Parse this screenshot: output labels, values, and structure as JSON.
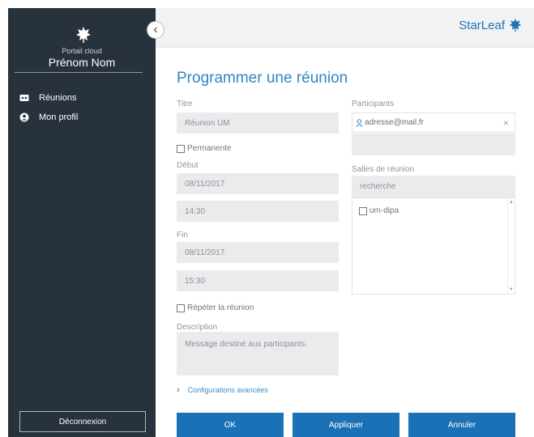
{
  "sidebar": {
    "portal_label": "Portail cloud",
    "user_name": "Prénom Nom",
    "items": [
      {
        "label": "Réunions",
        "icon": "meetings-icon"
      },
      {
        "label": "Mon profil",
        "icon": "profile-icon"
      }
    ],
    "logout_label": "Déconnexion"
  },
  "header": {
    "brand": "StarLeaf"
  },
  "form": {
    "title": "Programmer une réunion",
    "titre_label": "Titre",
    "titre_value": "Réunion UM",
    "permanente_label": "Permanente",
    "debut_label": "Début",
    "debut_date": "08/11/2017",
    "debut_time": "14:30",
    "fin_label": "Fin",
    "fin_date": "08/11/2017",
    "fin_time": "15:30",
    "repeter_label": "Répéter la réunion",
    "description_label": "Description",
    "description_placeholder": "Message destiné aux participants.",
    "participants_label": "Participants",
    "participant_email": "adresse@mail.fr",
    "salles_label": "Salles de réunion",
    "salles_search_placeholder": "recherche",
    "rooms": [
      {
        "label": "um-dipa",
        "checked": false
      }
    ],
    "advanced_label": "Configurations avancées"
  },
  "buttons": {
    "ok": "OK",
    "apply": "Appliquer",
    "cancel": "Annuler"
  },
  "colors": {
    "sidebar": "#27323d",
    "accent": "#1a71b5",
    "title": "#2f86c2",
    "field_bg": "#ebebed"
  }
}
